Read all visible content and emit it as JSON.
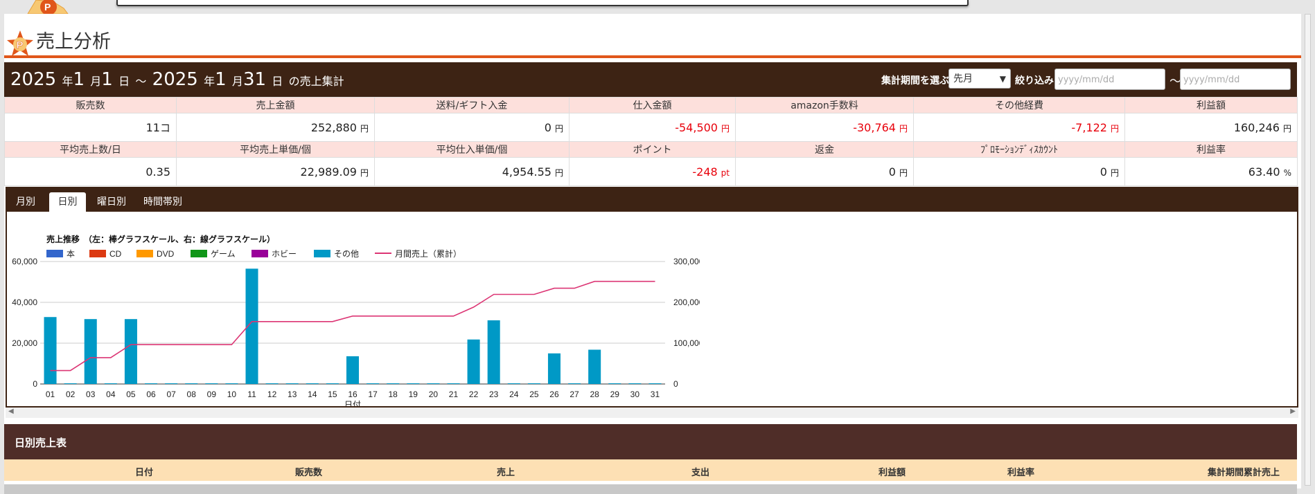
{
  "page_title": "売上分析",
  "header": {
    "start_year": "2025",
    "start_month": "1",
    "start_day": "1",
    "end_year": "2025",
    "end_month": "1",
    "end_day": "31",
    "year_unit": "年",
    "month_unit": "月",
    "day_unit": "日",
    "range_sep": "～",
    "suffix": "の売上集計",
    "period_label": "集計期間を選ぶ",
    "period_value": "先月",
    "filter_label": "絞り込み",
    "date_placeholder": "yyyy/mm/dd",
    "date_sep": "～"
  },
  "stats_row1": {
    "headers": [
      "販売数",
      "売上金額",
      "送料/ギフト入金",
      "仕入金額",
      "amazon手数料",
      "その他経費",
      "利益額"
    ],
    "values": [
      "11",
      "252,880",
      "0",
      "-54,500",
      "-30,764",
      "-7,122",
      "160,246"
    ],
    "units": [
      "コ",
      "円",
      "円",
      "円",
      "円",
      "円",
      "円"
    ]
  },
  "stats_row2": {
    "headers": [
      "平均売上数/日",
      "平均売上単価/個",
      "平均仕入単価/個",
      "ポイント",
      "返金",
      "ﾌﾟﾛﾓｰｼｮﾝﾃﾞｨｽｶｳﾝﾄ",
      "利益率"
    ],
    "values": [
      "0.35",
      "22,989.09",
      "4,954.55",
      "-248",
      "0",
      "0",
      "63.40"
    ],
    "units": [
      "",
      "円",
      "円",
      "pt",
      "円",
      "円",
      "%"
    ]
  },
  "tabs": [
    "月別",
    "日別",
    "曜日別",
    "時間帯別"
  ],
  "active_tab": "日別",
  "colors": {
    "brown": "#3d2314",
    "accent": "#e0561a",
    "negative": "#e8000b",
    "bar_other": "#0099c6",
    "line": "#dc3574"
  },
  "chart_data": {
    "type": "bar",
    "title": "売上推移　（左：棒グラフスケール、右：線グラフスケール）",
    "xlabel": "日付",
    "categories": [
      "01",
      "02",
      "03",
      "04",
      "05",
      "06",
      "07",
      "08",
      "09",
      "10",
      "11",
      "12",
      "13",
      "14",
      "15",
      "16",
      "17",
      "18",
      "19",
      "20",
      "21",
      "22",
      "23",
      "24",
      "25",
      "26",
      "27",
      "28",
      "29",
      "30",
      "31"
    ],
    "legend": [
      {
        "name": "本",
        "color": "#3366cc"
      },
      {
        "name": "CD",
        "color": "#dc3912"
      },
      {
        "name": "DVD",
        "color": "#ff9900"
      },
      {
        "name": "ゲーム",
        "color": "#109618"
      },
      {
        "name": "ホビー",
        "color": "#990099"
      },
      {
        "name": "その他",
        "color": "#0099c6"
      },
      {
        "name": "月間売上（累計）",
        "color": "#dc3574",
        "kind": "line"
      }
    ],
    "series": [
      {
        "name": "その他",
        "values": [
          32800,
          0,
          31800,
          0,
          31800,
          0,
          0,
          0,
          0,
          0,
          56500,
          0,
          0,
          0,
          0,
          13600,
          0,
          0,
          0,
          0,
          0,
          21800,
          31200,
          0,
          0,
          15000,
          0,
          16800,
          0,
          0,
          0
        ]
      },
      {
        "name": "月間売上（累計）",
        "axis": "right",
        "values": [
          32800,
          32800,
          64600,
          64600,
          96400,
          96400,
          96400,
          96400,
          96400,
          96400,
          152900,
          152900,
          152900,
          152900,
          152900,
          166500,
          166500,
          166500,
          166500,
          166500,
          166500,
          188300,
          219500,
          219500,
          219500,
          234500,
          234500,
          251300,
          251300,
          251300,
          251300
        ]
      }
    ],
    "left_ticks": [
      "0",
      "20,000",
      "40,000",
      "60,000"
    ],
    "right_ticks": [
      "0",
      "100,000",
      "200,000",
      "300,000"
    ],
    "ylim_left": [
      0,
      60000
    ],
    "ylim_right": [
      0,
      300000
    ]
  },
  "daily": {
    "title": "日別売上表",
    "columns": [
      "日付",
      "販売数",
      "売上",
      "支出",
      "利益額",
      "利益率",
      "集計期間累計売上"
    ]
  }
}
